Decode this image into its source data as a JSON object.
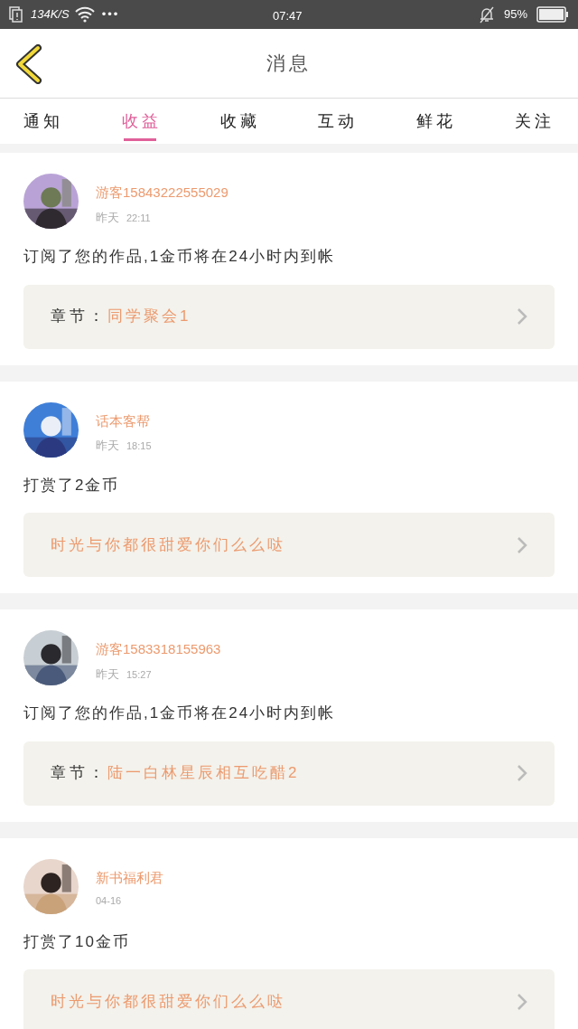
{
  "status_bar": {
    "speed": "134K/S",
    "dots": "•••",
    "time": "07:47",
    "battery": "95%"
  },
  "header": {
    "title": "消息"
  },
  "tabs": [
    {
      "label": "通知",
      "selected": false
    },
    {
      "label": "收益",
      "selected": true
    },
    {
      "label": "收藏",
      "selected": false
    },
    {
      "label": "互动",
      "selected": false
    },
    {
      "label": "鲜花",
      "selected": false
    },
    {
      "label": "关注",
      "selected": false
    }
  ],
  "messages": [
    {
      "name": "游客15843222555029",
      "date": "昨天",
      "time": "22:11",
      "text": "订阅了您的作品,1金币将在24小时内到帐",
      "link": {
        "kind": "chapter",
        "label": "章节：",
        "title": "同学聚会1"
      }
    },
    {
      "name": "话本客帮",
      "date": "昨天",
      "time": "18:15",
      "text": "打赏了2金币",
      "link": {
        "kind": "book",
        "title": "时光与你都很甜爱你们么么哒"
      }
    },
    {
      "name": "游客1583318155963",
      "date": "昨天",
      "time": "15:27",
      "text": "订阅了您的作品,1金币将在24小时内到帐",
      "link": {
        "kind": "chapter",
        "label": "章节：",
        "title": "陆一白林星辰相互吃醋2"
      }
    },
    {
      "name": "新书福利君",
      "time": "04-16",
      "text": "打赏了10金币",
      "link": {
        "kind": "book",
        "title": "时光与你都很甜爱你们么么哒"
      }
    }
  ]
}
